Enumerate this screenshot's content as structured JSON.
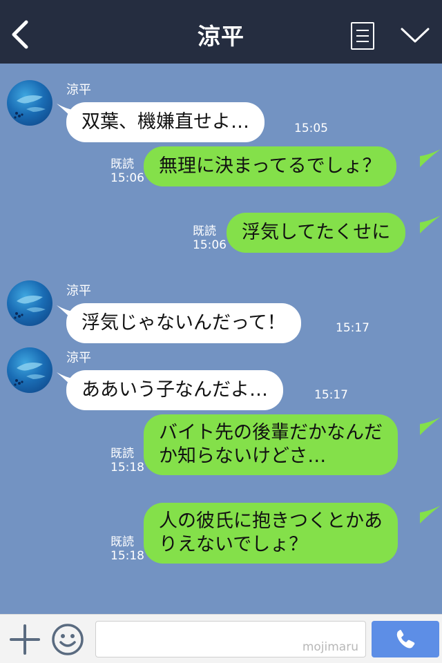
{
  "header": {
    "title": "涼平"
  },
  "messages": [
    {
      "type": "in",
      "sender": "涼平",
      "text": "双葉、機嫌直せよ…",
      "time": "15:05"
    },
    {
      "type": "out",
      "read": "既読",
      "time": "15:06",
      "text": "無理に決まってるでしょ？"
    },
    {
      "type": "out",
      "read": "既読",
      "time": "15:06",
      "text": "浮気してたくせに"
    },
    {
      "type": "in",
      "sender": "涼平",
      "text": "浮気じゃないんだって！",
      "time": "15:17"
    },
    {
      "type": "in",
      "sender": "涼平",
      "text": "ああいう子なんだよ…",
      "time": "15:17"
    },
    {
      "type": "out",
      "read": "既読",
      "time": "15:18",
      "lines": [
        "バイト先の後輩だかなんだ",
        "か知らないけどさ…"
      ]
    },
    {
      "type": "out",
      "read": "既読",
      "time": "15:18",
      "lines": [
        "人の彼氏に抱きつくとかあ",
        "りえないでしょ？"
      ]
    }
  ],
  "input": {
    "watermark": "mojimaru"
  },
  "colors": {
    "header": "#252d40",
    "background": "#7393c2",
    "outgoing": "#84e04a",
    "incoming": "#ffffff",
    "call_button": "#5d8ee6"
  },
  "icons": {
    "back": "chevron-left-icon",
    "menu": "list-icon",
    "collapse": "chevron-down-icon",
    "plus": "plus-icon",
    "emoji": "smiley-icon",
    "call": "phone-icon"
  }
}
